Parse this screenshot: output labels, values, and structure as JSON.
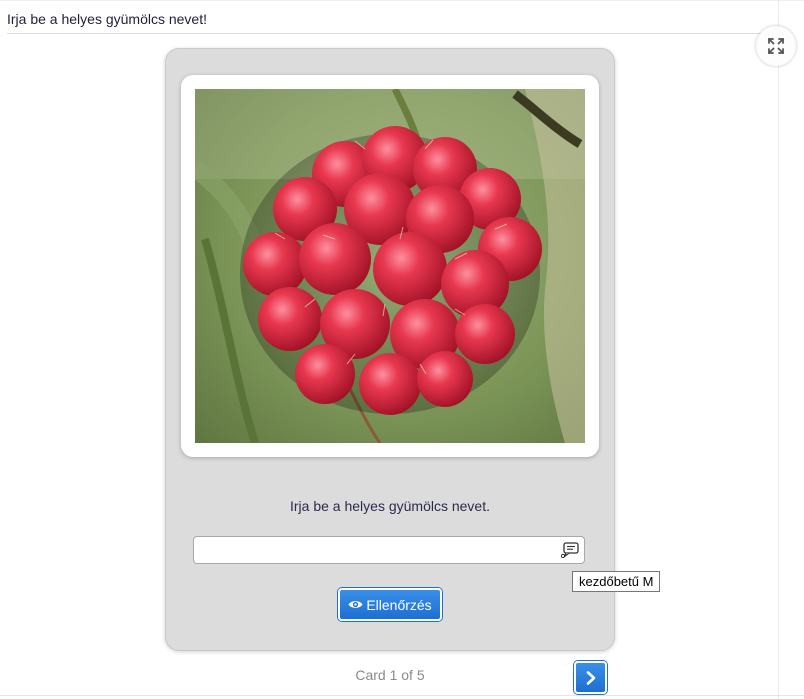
{
  "task": {
    "title": "Irja be a helyes gyümölcs nevet!"
  },
  "toolbar": {
    "fullscreen_icon": "fullscreen-expand-icon"
  },
  "card": {
    "image_icon": "raspberry-photo",
    "question": "Irja be a helyes gyümölcs nevet.",
    "answer_value": "",
    "tip_icon": "tip-speech-bubble-icon",
    "tooltip": "kezdőbetű M",
    "check_label": "Ellenőrzés",
    "check_icon": "eye-icon"
  },
  "navigation": {
    "counter": "Card 1 of 5",
    "next_icon": "chevron-right-icon"
  },
  "colors": {
    "accent": "#1d6fd1",
    "card_background": "#dcdcdc",
    "text": "#2b2b4d"
  }
}
